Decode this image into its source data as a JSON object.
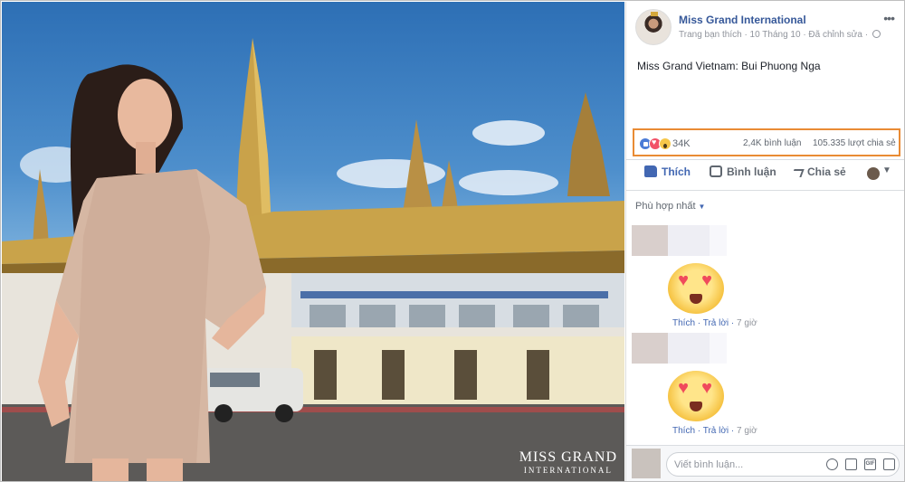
{
  "post": {
    "page_name": "Miss Grand International",
    "meta": "Trang bạn thích · 10 Tháng 10 · Đã chỉnh sửa ·",
    "caption": "Miss Grand Vietnam: Bui Phuong Nga"
  },
  "photo": {
    "watermark_line1": "MISS GRAND",
    "watermark_line2": "INTERNATIONAL"
  },
  "stats": {
    "reactions_count": "34K",
    "comments": "2,4K bình luận",
    "shares": "105.335 lượt chia sẻ"
  },
  "actions": {
    "like": "Thích",
    "comment": "Bình luận",
    "share": "Chia sẻ"
  },
  "sort_label": "Phù hợp nhất",
  "comments": [
    {
      "like": "Thích",
      "reply": "Trả lời",
      "time": "7 giờ"
    },
    {
      "like": "Thích",
      "reply": "Trả lời",
      "time": "7 giờ"
    }
  ],
  "composer": {
    "placeholder": "Viết bình luận...",
    "gif": "GIF"
  },
  "icons": [
    "globe-icon",
    "more-icon",
    "like-reaction-icon",
    "love-reaction-icon",
    "wow-reaction-icon",
    "like-icon",
    "comment-icon",
    "share-icon",
    "emoji-icon",
    "camera-icon",
    "gif-icon",
    "sticker-icon"
  ],
  "colors": {
    "link": "#365899",
    "accent": "#4267b2",
    "highlight_box": "#e98b34"
  }
}
